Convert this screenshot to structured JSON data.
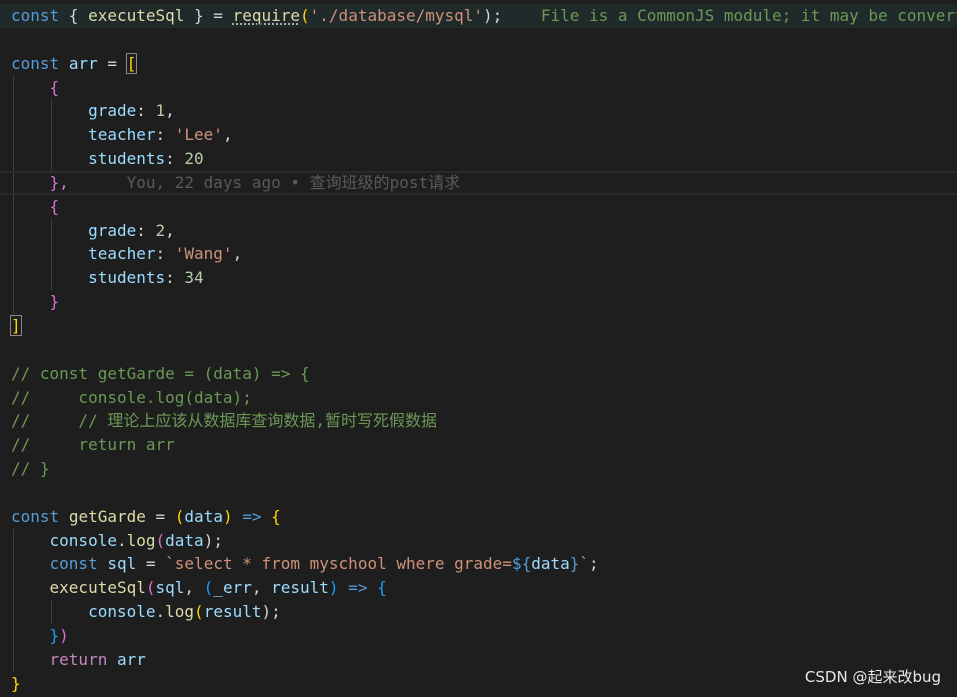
{
  "colors": {
    "background": "#1e1e1e",
    "keyword": "#569cd6",
    "control_keyword": "#c586c0",
    "variable": "#9cdcfe",
    "function": "#dcdcaa",
    "string": "#ce9178",
    "number": "#b5cea8",
    "comment": "#6a9955",
    "blame": "#5a5a5a"
  },
  "code": {
    "l1": {
      "kw": "const",
      "lb": " { ",
      "id": "executeSql",
      "rb": " } = ",
      "req": "require",
      "op": "(",
      "str": "'./database/mysql'",
      "cl": ");",
      "hint": "File is a CommonJS module; it may be converted to an ES module."
    },
    "l3": {
      "kw": "const",
      "name": "arr",
      "eq": " = ",
      "open": "["
    },
    "open_brace": "{",
    "close_brace": "}",
    "close_brace_comma": "},",
    "close_bracket": "]",
    "obj1": {
      "grade_key": "grade",
      "grade_val": "1",
      "teacher_key": "teacher",
      "teacher_val": "'Lee'",
      "students_key": "students",
      "students_val": "20"
    },
    "blame": "You, 22 days ago • 查询班级的post请求",
    "obj2": {
      "grade_key": "grade",
      "grade_val": "2",
      "teacher_key": "teacher",
      "teacher_val": "'Wang'",
      "students_key": "students",
      "students_val": "34"
    },
    "comments": [
      "// const getGarde = (data) => {",
      "//     console.log(data);",
      "//     // 理论上应该从数据库查询数据,暂时写死假数据",
      "//     return arr",
      "// }"
    ],
    "fn_decl": {
      "kw": "const",
      "name": "getGarde",
      "eq": " = ",
      "lp": "(",
      "param": "data",
      "rp": ")",
      "arrow": " =>",
      "lb": " {"
    },
    "log1": {
      "obj": "console",
      "method": "log",
      "lp": "(",
      "arg": "data",
      "rp": ");"
    },
    "sql": {
      "kw": "const",
      "name": "sql",
      "eq": " = ",
      "tpl": "`select * from myschool where grade=",
      "interp_open": "${",
      "interp_var": "data",
      "interp_close": "}",
      "tpl_end": "`",
      "semi": ";"
    },
    "exec": {
      "fn": "executeSql",
      "lp": "(",
      "arg1": "sql",
      "comma": ", ",
      "lp2": "(",
      "err": "_err",
      "comma2": ", ",
      "res": "result",
      "rp2": ")",
      "arrow": " =>",
      "lb": " {"
    },
    "log2": {
      "obj": "console",
      "method": "log",
      "lp": "(",
      "arg": "result",
      "rp": ");"
    },
    "close_exec_b": "}",
    "close_exec_p": ")",
    "ret": {
      "kw": "return",
      "val": "arr"
    },
    "close_fn": "}"
  },
  "watermark": "CSDN @起来改bug"
}
